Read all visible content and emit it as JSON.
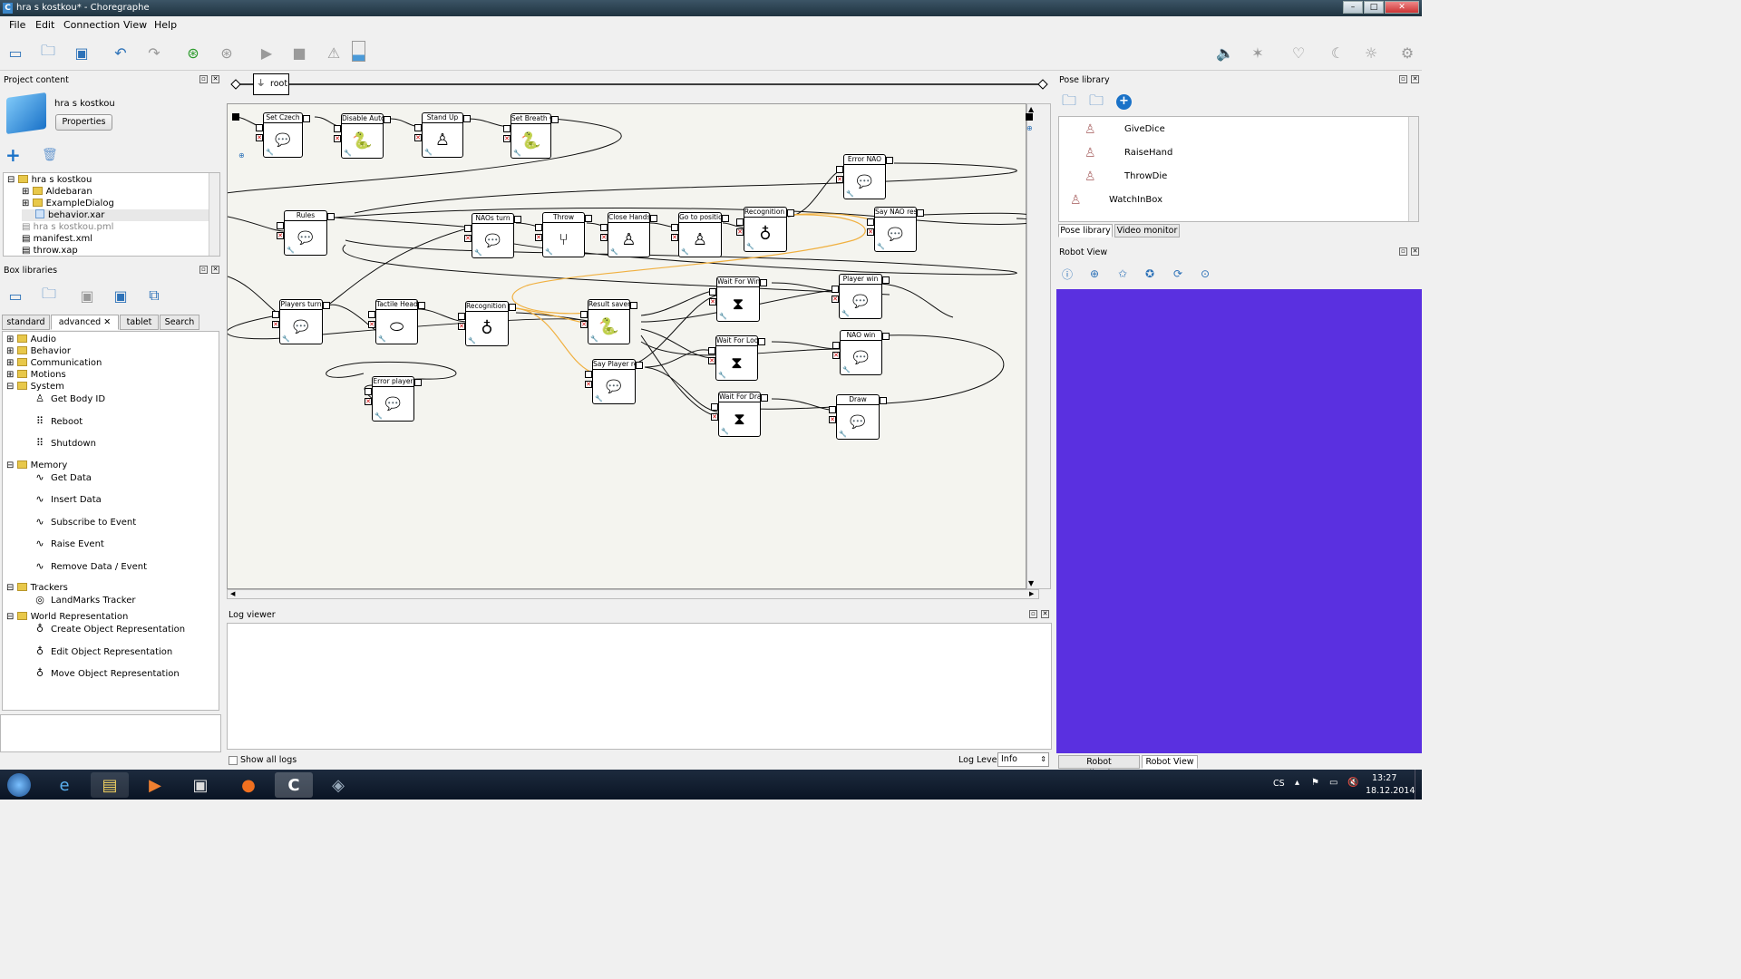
{
  "window": {
    "title": "hra s kostkou* - Choregraphe",
    "app_letter": "C"
  },
  "menu": [
    "File",
    "Edit",
    "Connection",
    "View",
    "Help"
  ],
  "project": {
    "header": "Project content",
    "name": "hra s kostkou",
    "properties_btn": "Properties",
    "tree": [
      {
        "label": "hra s kostkou",
        "kind": "folder",
        "level": 0
      },
      {
        "label": "Aldebaran",
        "kind": "folder",
        "level": 1
      },
      {
        "label": "ExampleDialog",
        "kind": "folder",
        "level": 1
      },
      {
        "label": "behavior.xar",
        "kind": "file-selected",
        "level": 1
      },
      {
        "label": "hra s kostkou.pml",
        "kind": "file-gray",
        "level": 0
      },
      {
        "label": "manifest.xml",
        "kind": "file",
        "level": 0
      },
      {
        "label": "throw.xap",
        "kind": "file",
        "level": 0
      }
    ]
  },
  "box_libraries": {
    "header": "Box libraries",
    "tabs": [
      "standard",
      "advanced",
      "tablet",
      "Search"
    ],
    "active_tab": "advanced",
    "items": [
      {
        "label": "Audio",
        "kind": "folder",
        "level": 0
      },
      {
        "label": "Behavior",
        "kind": "folder",
        "level": 0
      },
      {
        "label": "Communication",
        "kind": "folder",
        "level": 0
      },
      {
        "label": "Motions",
        "kind": "folder",
        "level": 0
      },
      {
        "label": "System",
        "kind": "folder-open",
        "level": 0
      },
      {
        "label": "Get Body ID",
        "kind": "robot",
        "level": 1
      },
      {
        "label": "Reboot",
        "kind": "dots",
        "level": 1
      },
      {
        "label": "Shutdown",
        "kind": "dots",
        "level": 1
      },
      {
        "label": "Memory",
        "kind": "folder-open",
        "level": 0
      },
      {
        "label": "Get Data",
        "kind": "wave",
        "level": 1
      },
      {
        "label": "Insert Data",
        "kind": "wave",
        "level": 1
      },
      {
        "label": "Subscribe to Event",
        "kind": "wave",
        "level": 1
      },
      {
        "label": "Raise Event",
        "kind": "wave",
        "level": 1
      },
      {
        "label": "Remove Data / Event",
        "kind": "wave",
        "level": 1
      },
      {
        "label": "Trackers",
        "kind": "folder-open",
        "level": 0
      },
      {
        "label": "LandMarks Tracker",
        "kind": "eye",
        "level": 1
      },
      {
        "label": "World Representation",
        "kind": "folder-open",
        "level": 0
      },
      {
        "label": "Create Object Representation",
        "kind": "obj",
        "level": 1
      },
      {
        "label": "Edit Object Representation",
        "kind": "obj",
        "level": 1
      },
      {
        "label": "Move Object Representation",
        "kind": "obj",
        "level": 1
      }
    ]
  },
  "breadcrumb": {
    "root": "root"
  },
  "boxes": [
    {
      "id": "b1",
      "title": "Set Czech",
      "icon": "speech"
    },
    {
      "id": "b2",
      "title": "Disable Autonomo",
      "icon": "python"
    },
    {
      "id": "b3",
      "title": "Stand Up",
      "icon": "robot"
    },
    {
      "id": "b4",
      "title": "Set Breath Off",
      "icon": "python"
    },
    {
      "id": "b5",
      "title": "Error NAO",
      "icon": "speech"
    },
    {
      "id": "b6",
      "title": "Rules",
      "icon": "speech"
    },
    {
      "id": "b7",
      "title": "NAOs turn",
      "icon": "speech"
    },
    {
      "id": "b8",
      "title": "Throw",
      "icon": "flow"
    },
    {
      "id": "b9",
      "title": "Close Hands",
      "icon": "robot"
    },
    {
      "id": "b10",
      "title": "Go to position Wai",
      "icon": "pose"
    },
    {
      "id": "b11",
      "title": "Recognition NAO",
      "icon": "obj"
    },
    {
      "id": "b12",
      "title": "Say NAO result",
      "icon": "speech"
    },
    {
      "id": "b13",
      "title": "Players turn",
      "icon": "speech"
    },
    {
      "id": "b14",
      "title": "Tactile Head",
      "icon": "head"
    },
    {
      "id": "b15",
      "title": "Recognition Playe",
      "icon": "obj"
    },
    {
      "id": "b16",
      "title": "Result saver",
      "icon": "python"
    },
    {
      "id": "b17",
      "title": "Wait For Win",
      "icon": "hourglass"
    },
    {
      "id": "b18",
      "title": "Player win",
      "icon": "speech"
    },
    {
      "id": "b19",
      "title": "Wait For Loose",
      "icon": "hourglass"
    },
    {
      "id": "b20",
      "title": "NAO win",
      "icon": "speech"
    },
    {
      "id": "b21",
      "title": "Error player",
      "icon": "speech"
    },
    {
      "id": "b22",
      "title": "Say Player result",
      "icon": "speech"
    },
    {
      "id": "b23",
      "title": "Wait For Draw",
      "icon": "hourglass"
    },
    {
      "id": "b24",
      "title": "Draw",
      "icon": "speech"
    }
  ],
  "log_viewer": {
    "header": "Log viewer",
    "show_all_logs": "Show all logs",
    "log_level_label": "Log Level:",
    "log_level_value": "Info"
  },
  "pose_library": {
    "header": "Pose library",
    "items": [
      "GiveDice",
      "RaiseHand",
      "ThrowDie",
      "WatchInBox"
    ],
    "tabs": [
      "Pose library",
      "Video monitor"
    ]
  },
  "robot_view": {
    "header": "Robot View",
    "bg_color": "#5a30e0",
    "tabs": [
      "Robot Applications",
      "Robot View"
    ]
  },
  "taskbar": {
    "lang": "CS",
    "time": "13:27",
    "date": "18.12.2014"
  }
}
